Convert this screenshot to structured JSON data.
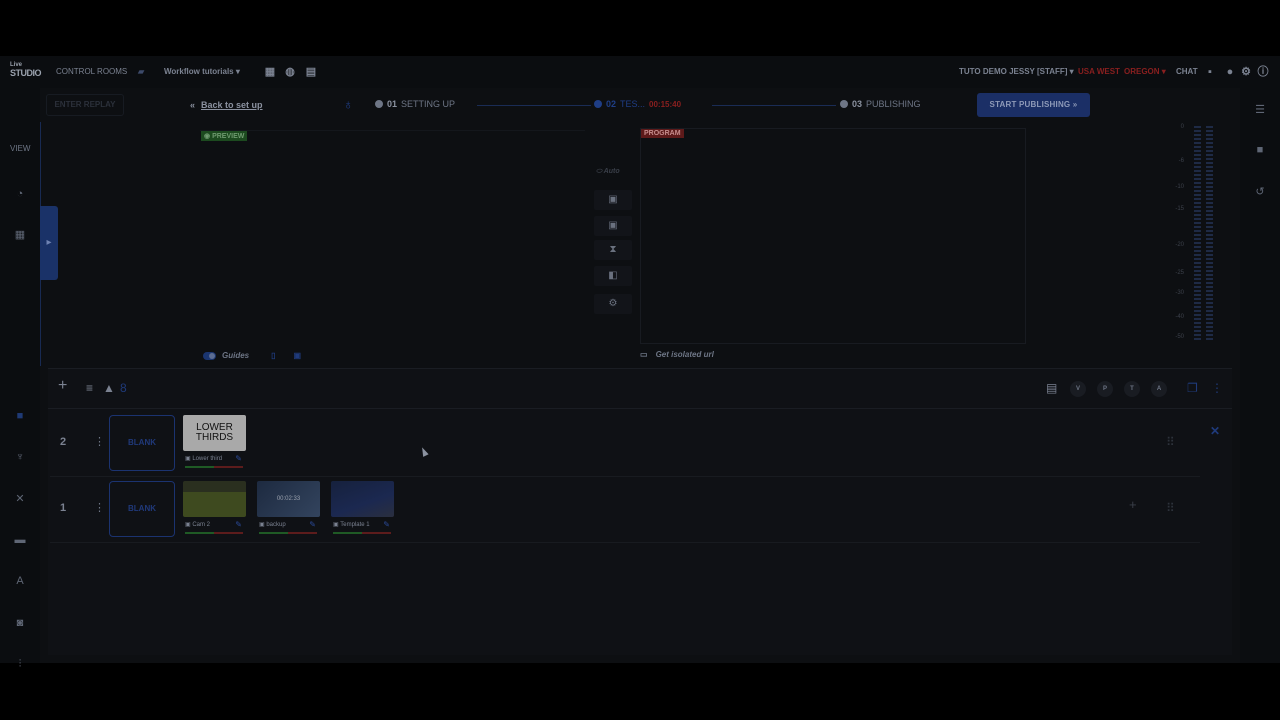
{
  "app": {
    "logo_top": "Live",
    "logo_main": "STUDIO",
    "control_rooms": "CONTROL ROOMS",
    "workflow": "Workflow tutorials",
    "user": "TUTO DEMO JESSY [STAFF]",
    "region": "USA WEST",
    "zone": "OREGON",
    "chat": "CHAT"
  },
  "rail": {
    "view_label": "VIEW"
  },
  "stepper": {
    "enter_replay": "ENTER REPLAY",
    "back": "Back to set up",
    "steps": [
      {
        "num": "01",
        "label": "SETTING UP"
      },
      {
        "num": "02",
        "label": "TES..."
      },
      {
        "num": "03",
        "label": "PUBLISHING"
      }
    ],
    "timer": "00:15:40",
    "start_publishing": "START PUBLISHING"
  },
  "preview": {
    "badge": "PREVIEW"
  },
  "program": {
    "badge": "PROGRAM"
  },
  "transition": {
    "auto_label": "Auto"
  },
  "meter": {
    "ticks": [
      "0",
      "-6",
      "-10",
      "-15",
      "-20",
      "-25",
      "-30",
      "-40",
      "-50",
      "-60"
    ]
  },
  "footer": {
    "guides": "Guides",
    "isolated": "Get isolated url"
  },
  "rundown": {
    "toolbar_count": "8",
    "circle_buttons": [
      "V",
      "P",
      "T",
      "A"
    ],
    "rows": [
      {
        "num": "2",
        "blank": "BLANK",
        "tiles": [
          {
            "caption": "Lower third",
            "thumb_text": "LOWER THIRDS"
          }
        ]
      },
      {
        "num": "1",
        "blank": "BLANK",
        "tiles": [
          {
            "caption": "Cam 2"
          },
          {
            "caption": "backup",
            "duration": "00:02:33"
          },
          {
            "caption": "Template 1"
          }
        ]
      }
    ]
  },
  "colors": {
    "accent": "#1f3e86",
    "live_red": "#8a1f1f",
    "preview_green": "#1c4a1f"
  }
}
